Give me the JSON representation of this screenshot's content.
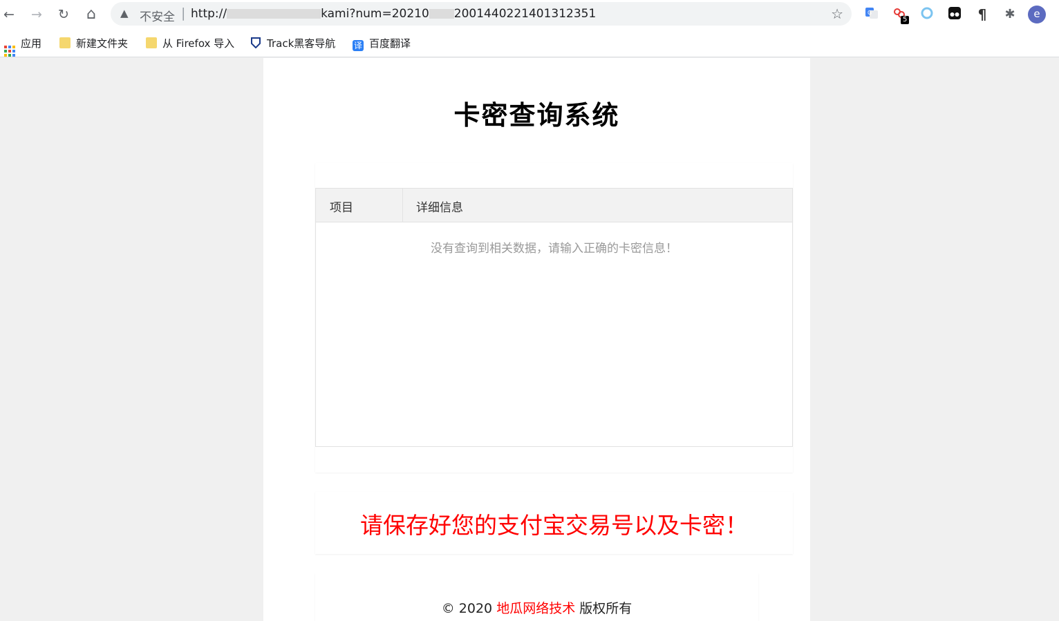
{
  "browser": {
    "nav": {
      "back_icon": "←",
      "forward_icon": "→",
      "reload_icon": "↻",
      "home_icon": "⌂"
    },
    "omnibox": {
      "warning_icon": "▲",
      "security_label": "不安全",
      "separator": "|",
      "url_prefix": "http://",
      "url_middle": "kami?num=20210",
      "url_suffix": "2001440221401312351",
      "bookmark_star": "☆"
    },
    "extensions": {
      "badge_count": "5",
      "pilcrow": "¶",
      "puzzle": "✱",
      "profile_initial": "e"
    }
  },
  "bookmarks": [
    {
      "label": "应用"
    },
    {
      "label": "新建文件夹"
    },
    {
      "label": "从 Firefox 导入"
    },
    {
      "label": "Track黑客导航"
    },
    {
      "label": "百度翻译"
    }
  ],
  "page": {
    "title": "卡密查询系统",
    "table": {
      "headers": [
        "项目",
        "详细信息"
      ],
      "empty_message": "没有查询到相关数据，请输入正确的卡密信息！"
    },
    "notice": "请保存好您的支付宝交易号以及卡密！",
    "footer": {
      "prefix": "© 2020 ",
      "company": "地瓜网络技术",
      "suffix": " 版权所有"
    }
  }
}
